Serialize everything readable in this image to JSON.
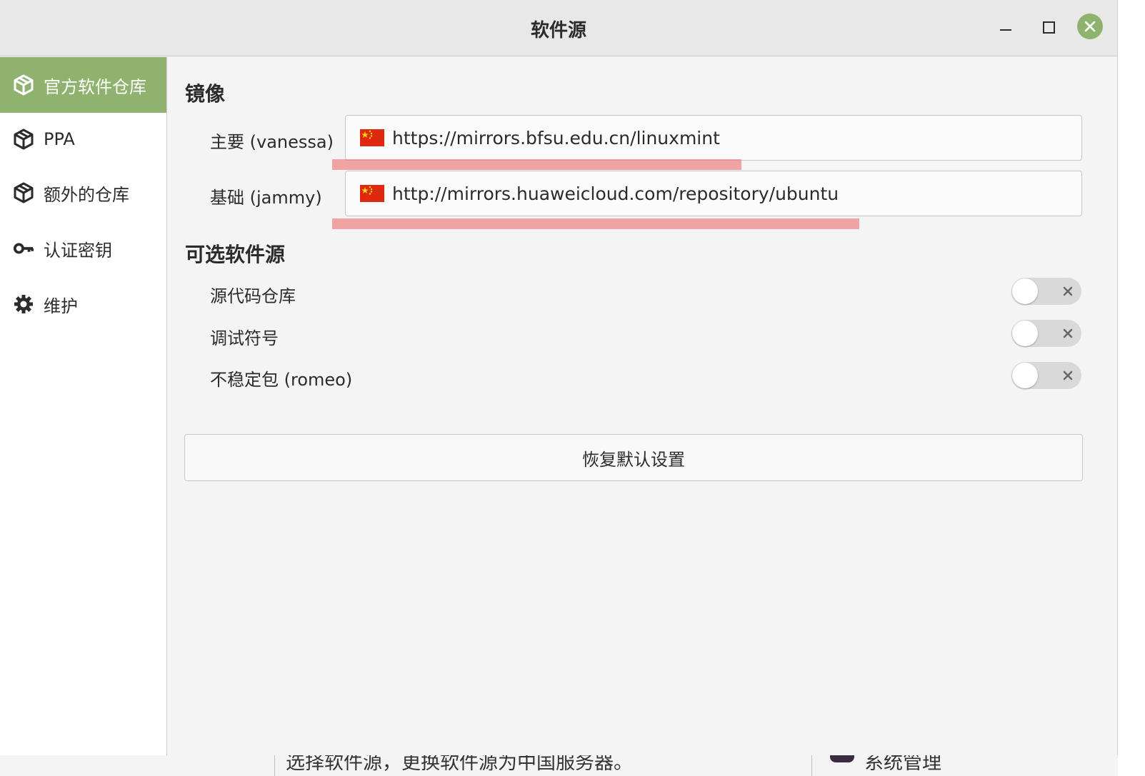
{
  "window": {
    "title": "软件源",
    "controls": [
      "minimize-icon",
      "maximize-icon",
      "close-icon"
    ],
    "accent_color": "#8fb36e"
  },
  "sidebar": {
    "items": [
      {
        "label": "官方软件仓库",
        "icon": "package-icon",
        "active": true
      },
      {
        "label": "PPA",
        "icon": "package-icon",
        "active": false
      },
      {
        "label": "额外的仓库",
        "icon": "package-icon",
        "active": false
      },
      {
        "label": "认证密钥",
        "icon": "key-icon",
        "active": false
      },
      {
        "label": "维护",
        "icon": "gear-icon",
        "active": false
      }
    ]
  },
  "mirrors": {
    "title": "镜像",
    "main": {
      "label": "主要 (vanessa)",
      "flag": "cn-flag-icon",
      "url": "https://mirrors.bfsu.edu.cn/linuxmint"
    },
    "base": {
      "label": "基础 (jammy)",
      "flag": "cn-flag-icon",
      "url": "http://mirrors.huaweicloud.com/repository/ubuntu"
    }
  },
  "optional": {
    "title": "可选软件源",
    "items": [
      {
        "label": "源代码仓库",
        "enabled": false
      },
      {
        "label": "调试符号",
        "enabled": false
      },
      {
        "label": "不稳定包 (romeo)",
        "enabled": false
      }
    ]
  },
  "restore_button": "恢复默认设置",
  "background_window": {
    "text_left": "选择软件源，更换软件源为中国服务器。",
    "text_right": "系统管理"
  }
}
